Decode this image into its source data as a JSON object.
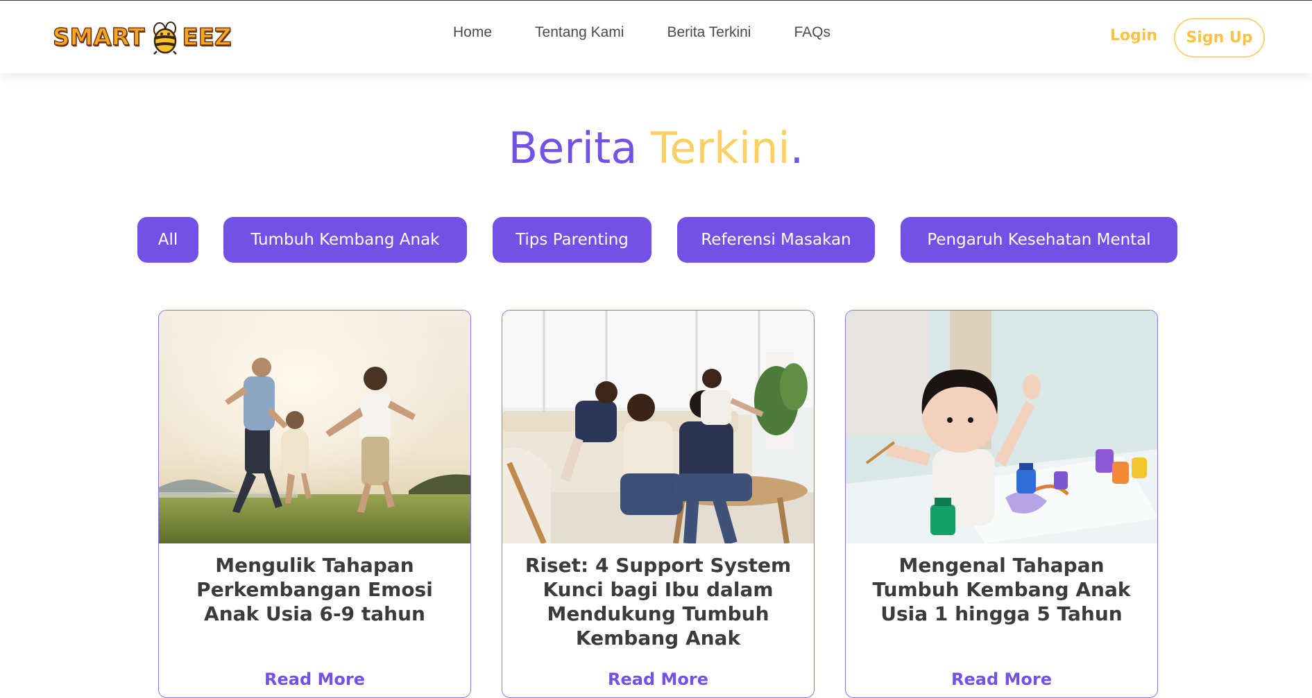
{
  "brand": {
    "logo_left": "SMART",
    "logo_right": "EEZ"
  },
  "nav": {
    "links": [
      "Home",
      "Tentang Kami",
      "Berita Terkini",
      "FAQs"
    ],
    "login_label": "Login",
    "signup_label": "Sign Up"
  },
  "page": {
    "title_part1": "Berita ",
    "title_part2": "Terkini",
    "title_part3": "."
  },
  "filters": [
    "All",
    "Tumbuh Kembang Anak",
    "Tips Parenting",
    "Referensi Masakan",
    "Pengaruh Kesehatan Mental"
  ],
  "articles": [
    {
      "title": "Mengulik Tahapan Perkembangan Emosi Anak Usia 6-9 tahun",
      "read_more": "Read More"
    },
    {
      "title": "Riset: 4 Support System Kunci bagi Ibu dalam Mendukung Tumbuh Kembang Anak",
      "read_more": "Read More"
    },
    {
      "title": "Mengenal Tahapan Tumbuh Kembang Anak Usia 1 hingga 5 Tahun",
      "read_more": "Read More"
    }
  ],
  "colors": {
    "primary": "#7451e6",
    "accent": "#fbd062",
    "logo_orange": "#f5a623"
  }
}
